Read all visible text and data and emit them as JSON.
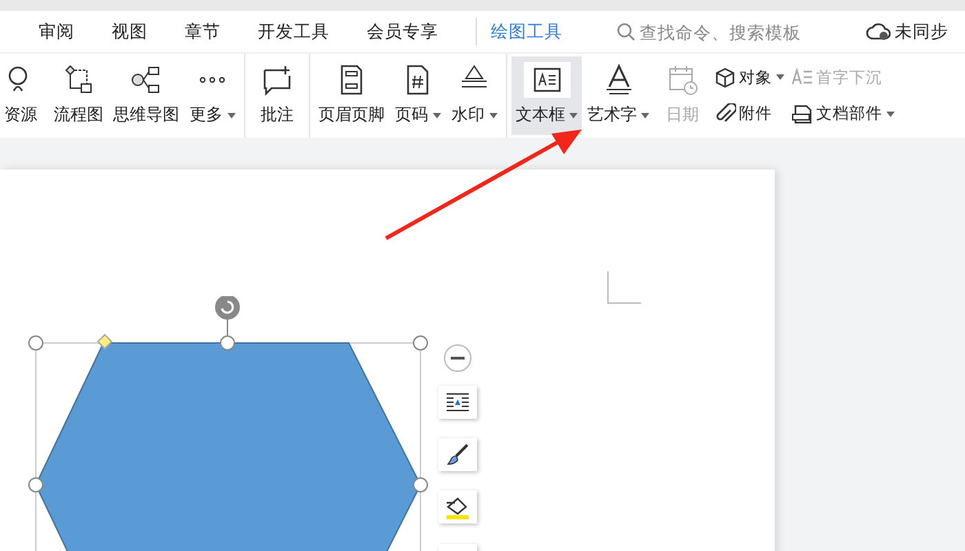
{
  "tabs": [
    {
      "label": "审阅",
      "selected": false
    },
    {
      "label": "视图",
      "selected": false
    },
    {
      "label": "章节",
      "selected": false
    },
    {
      "label": "开发工具",
      "selected": false
    },
    {
      "label": "会员专享",
      "selected": false
    },
    {
      "label": "绘图工具",
      "selected": true
    }
  ],
  "search": {
    "placeholder": "查找命令、搜索模板"
  },
  "sync": {
    "label": "未同步"
  },
  "ribbon": [
    [
      {
        "label": "资源",
        "kind": "big",
        "dropdown": false,
        "disabled": false,
        "selected": false
      },
      {
        "label": "流程图",
        "kind": "big",
        "dropdown": false,
        "disabled": false,
        "selected": false
      },
      {
        "label": "思维导图",
        "kind": "big",
        "dropdown": false,
        "disabled": false,
        "selected": false
      },
      {
        "label": "更多",
        "kind": "big",
        "dropdown": true,
        "disabled": false,
        "selected": false
      }
    ],
    [
      {
        "label": "批注",
        "kind": "big",
        "dropdown": false,
        "disabled": false,
        "selected": false
      }
    ],
    [
      {
        "label": "页眉页脚",
        "kind": "big",
        "dropdown": false,
        "disabled": false,
        "selected": false
      },
      {
        "label": "页码",
        "kind": "big",
        "dropdown": true,
        "disabled": false,
        "selected": false
      },
      {
        "label": "水印",
        "kind": "big",
        "dropdown": true,
        "disabled": false,
        "selected": false
      }
    ],
    [
      {
        "label": "文本框",
        "kind": "big",
        "dropdown": true,
        "disabled": false,
        "selected": true
      },
      {
        "label": "艺术字",
        "kind": "big",
        "dropdown": true,
        "disabled": false,
        "selected": false
      },
      {
        "label": "日期",
        "kind": "big",
        "dropdown": false,
        "disabled": true,
        "selected": false
      },
      {
        "label": "对象",
        "kind": "small",
        "dropdown": true,
        "disabled": false
      },
      {
        "label": "附件",
        "kind": "small",
        "dropdown": false,
        "disabled": false
      },
      {
        "label": "首字下沉",
        "kind": "small",
        "dropdown": false,
        "disabled": true
      },
      {
        "label": "文档部件",
        "kind": "small",
        "dropdown": true,
        "disabled": false
      }
    ]
  ]
}
